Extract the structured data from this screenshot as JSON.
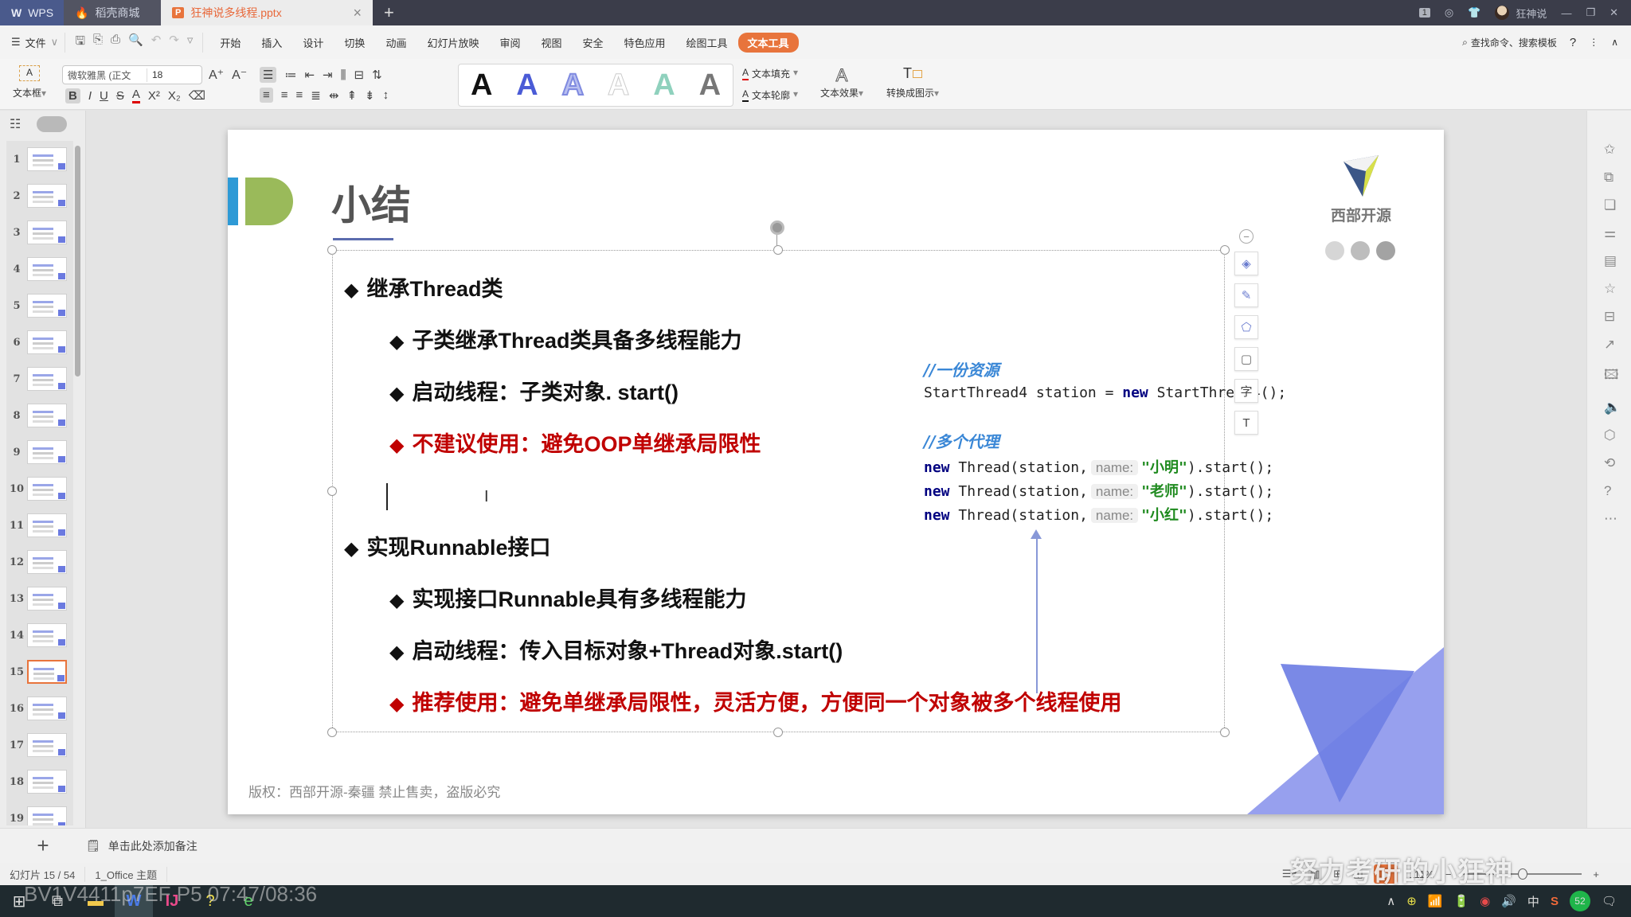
{
  "titlebar": {
    "tabs": [
      {
        "label": "WPS",
        "icon": "wps-logo-icon"
      },
      {
        "label": "稻壳商城",
        "icon": "docer-icon"
      },
      {
        "label": "狂神说多线程.pptx",
        "icon": "ppt-file-icon",
        "active": true
      }
    ],
    "add_tab": "+",
    "close_tab": "×",
    "window_count": "1",
    "username": "狂神说",
    "minimize": "—",
    "restore": "❐",
    "close": "✕"
  },
  "menubar": {
    "file_label": "文件",
    "items": [
      "开始",
      "插入",
      "设计",
      "切换",
      "动画",
      "幻灯片放映",
      "审阅",
      "视图",
      "安全",
      "特色应用",
      "绘图工具",
      "文本工具"
    ],
    "active_item": "文本工具",
    "search_label": "查找命令、搜索模板",
    "help": "?",
    "more": "⋮",
    "collapse": "∧"
  },
  "ribbon": {
    "textbox_label": "文本框",
    "font_name": "微软雅黑 (正文",
    "font_size": "18",
    "text_fill_label": "文本填充",
    "text_outline_label": "文本轮廓",
    "text_effect_label": "文本效果",
    "convert_label": "转换成图示",
    "style_letter": "A",
    "style_colors": [
      "#111111",
      "#4a5bd6",
      "#8e98e8",
      "#e8e8e8",
      "#8fd1bd",
      "#666666"
    ]
  },
  "slides_panel": {
    "slides": [
      "1",
      "2",
      "3",
      "4",
      "5",
      "6",
      "7",
      "8",
      "9",
      "10",
      "11",
      "12",
      "13",
      "14",
      "15",
      "16",
      "17",
      "18",
      "19"
    ],
    "selected": "15"
  },
  "slide": {
    "title": "小结",
    "bullets": [
      {
        "text": "继承Thread类",
        "level": 1,
        "red": false
      },
      {
        "text": "子类继承Thread类具备多线程能力",
        "level": 2,
        "red": false
      },
      {
        "text": "启动线程：子类对象. start()",
        "level": 2,
        "red": false
      },
      {
        "text": "不建议使用：避免OOP单继承局限性",
        "level": 2,
        "red": true
      },
      {
        "text": "实现Runnable接口",
        "level": 1,
        "red": false
      },
      {
        "text": "实现接口Runnable具有多线程能力",
        "level": 2,
        "red": false
      },
      {
        "text": "启动线程：传入目标对象+Thread对象.start()",
        "level": 2,
        "red": false
      },
      {
        "text": "推荐使用：避免单继承局限性，灵活方便，方便同一个对象被多个线程使用",
        "level": 2,
        "red": true
      }
    ],
    "bullet_glyph": "◆",
    "code": {
      "comment1": "//一份资源",
      "line1_a": "StartThread4 station = ",
      "line1_kw": "new",
      "line1_b": " StartThread4();",
      "comment2": "//多个代理",
      "thread_lines": [
        {
          "kw": "new",
          "pre": " Thread(station,",
          "hint": "name:",
          "str": "\"小明\"",
          "post": ").start();"
        },
        {
          "kw": "new",
          "pre": " Thread(station,",
          "hint": "name:",
          "str": "\"老师\"",
          "post": ").start();"
        },
        {
          "kw": "new",
          "pre": " Thread(station,",
          "hint": "name:",
          "str": "\"小红\"",
          "post": ").start();"
        }
      ]
    },
    "logo_text": "西部开源",
    "copyright": "版权：西部开源-秦疆    禁止售卖，盗版必究"
  },
  "notes": {
    "add_slide": "+",
    "placeholder": "单击此处添加备注"
  },
  "statusbar": {
    "slide_counter": "幻灯片 15 / 54",
    "theme": "1_Office 主题",
    "zoom": "111%",
    "zoom_minus": "−",
    "zoom_plus": "+",
    "overlay_watermark": "努力考研的小狂神"
  },
  "taskbar": {
    "video_overlay": "BV1V4411p7EF P5 07:47/08:36",
    "ime": "中",
    "battery_badge": "52"
  }
}
